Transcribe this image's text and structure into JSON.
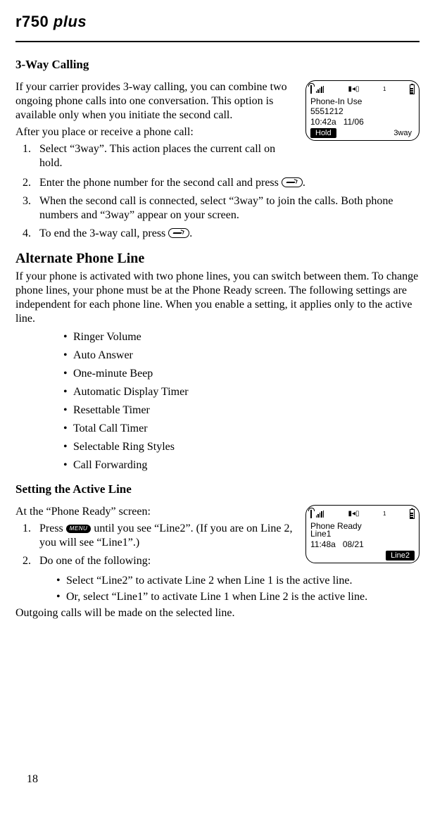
{
  "header": {
    "model": "r750",
    "suffix": "plus"
  },
  "page_number": "18",
  "sec1": {
    "title": "3-Way Calling",
    "intro": "If your carrier provides 3-way calling, you can combine two ongoing phone calls into one conversation. This option is available only when you initiate the second call.",
    "after": "After you place or receive a phone call:",
    "step1": "Select “3way”. This action places the current call on hold.",
    "step2a": "Enter the phone number for the second call and press ",
    "step2b": ".",
    "step3": "When the second call is connected, select “3way” to join the calls. Both phone numbers and “3way” appear on your screen.",
    "step4a": "To end the 3-way call, press ",
    "step4b": "."
  },
  "phone1": {
    "line1": "Phone-In Use",
    "line2": "5551212",
    "line3": "10:42a   11/06",
    "sk_left": "Hold",
    "sk_right": "3way",
    "one": "1"
  },
  "sec2": {
    "title": "Alternate Phone Line",
    "intro": "If your phone is activated with two phone lines, you can switch between them. To change phone lines, your phone must be at the Phone Ready screen. The following settings are independent for each phone line. When you enable a setting, it applies only to the active line.",
    "b1": "Ringer Volume",
    "b2": "Auto Answer",
    "b3": "One-minute Beep",
    "b4": "Automatic Display Timer",
    "b5": "Resettable Timer",
    "b6": "Total Call Timer",
    "b7": "Selectable Ring Styles",
    "b8": "Call Forwarding"
  },
  "sec3": {
    "title": "Setting the Active Line",
    "intro": "At the “Phone Ready” screen:",
    "step1a": "Press ",
    "menu_label": "MENU",
    "step1b": " until you see “Line2”. (If you are on Line 2, you will see “Line1”.)",
    "step2": "Do one of the following:",
    "sub1": "Select “Line2” to activate Line 2 when Line 1 is the active line.",
    "sub2": "Or, select “Line1” to activate Line 1 when Line 2 is the active line.",
    "closing": "Outgoing calls will be made on the selected line."
  },
  "phone2": {
    "line1": "Phone Ready",
    "line2": "Line1",
    "line3": "11:48a   08/21",
    "sk_right": "Line2",
    "one": "1"
  }
}
